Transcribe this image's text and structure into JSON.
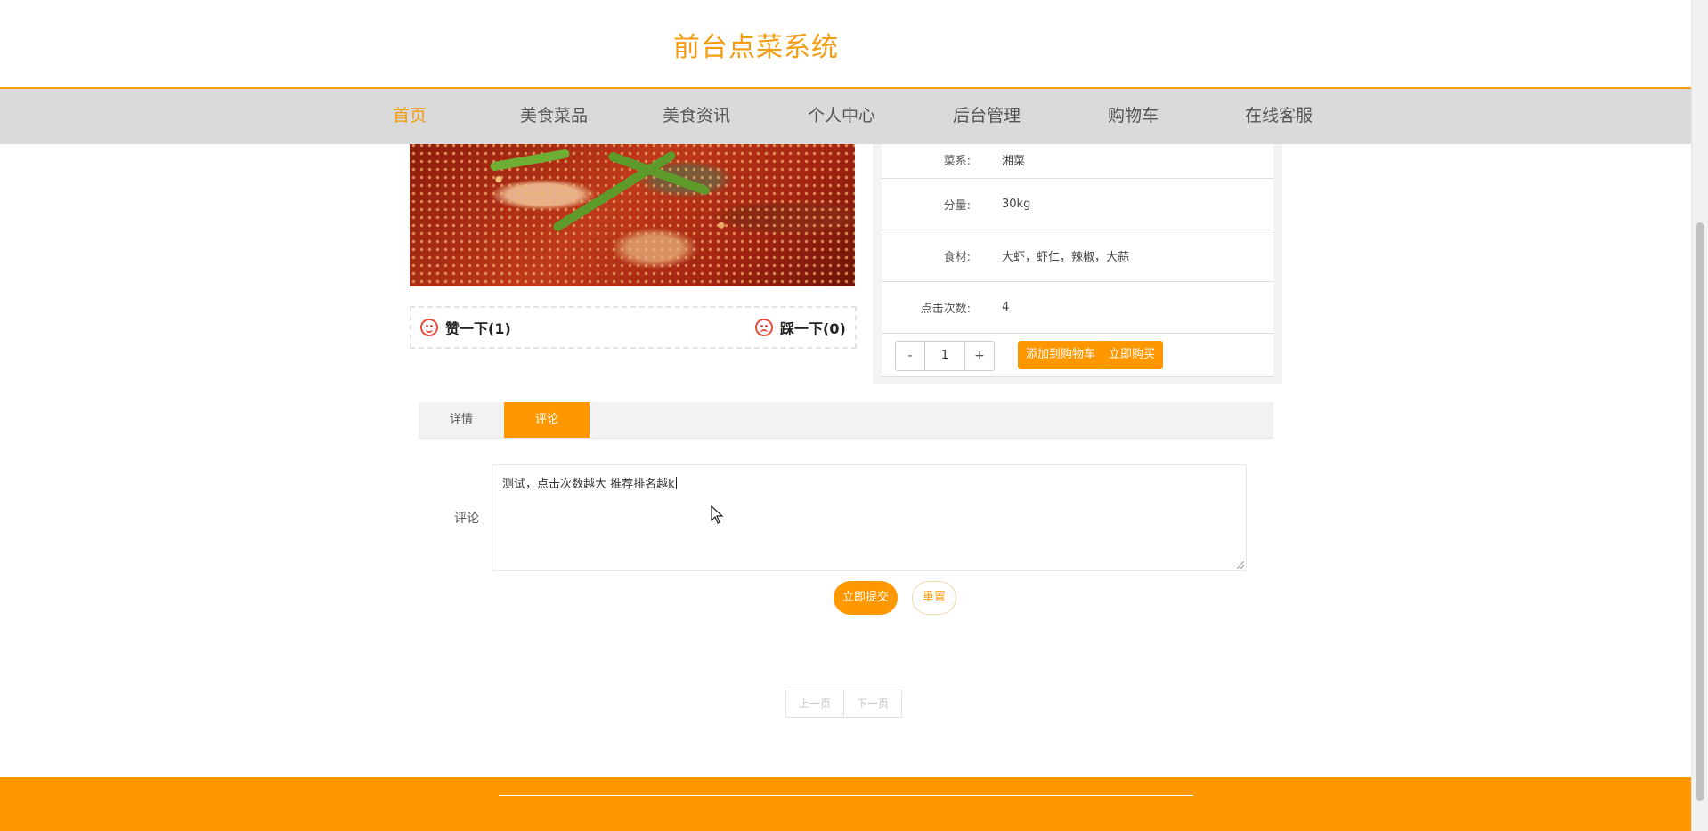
{
  "header": {
    "site_title": "前台点菜系统"
  },
  "nav": {
    "items": [
      {
        "label": "首页",
        "active": true
      },
      {
        "label": "美食菜品",
        "active": false
      },
      {
        "label": "美食资讯",
        "active": false
      },
      {
        "label": "个人中心",
        "active": false
      },
      {
        "label": "后台管理",
        "active": false
      },
      {
        "label": "购物车",
        "active": false
      },
      {
        "label": "在线客服",
        "active": false
      }
    ]
  },
  "votes": {
    "like_label": "赞一下(1)",
    "dislike_label": "踩一下(0)"
  },
  "product_info": {
    "rows": [
      {
        "label": "菜系:",
        "value": "湘菜"
      },
      {
        "label": "分量:",
        "value": "30kg"
      },
      {
        "label": "食材:",
        "value": "大虾，虾仁，辣椒，大蒜"
      },
      {
        "label": "点击次数:",
        "value": "4"
      }
    ],
    "quantity": {
      "minus": "-",
      "value": "1",
      "plus": "+"
    },
    "add_to_cart_label": "添加到购物车",
    "buy_now_label": "立即购买"
  },
  "tabs": [
    {
      "label": "详情",
      "active": false
    },
    {
      "label": "评论",
      "active": true
    }
  ],
  "comment_form": {
    "label": "评论",
    "value": "测试，点击次数越大 推荐排名越k",
    "submit_label": "立即提交",
    "reset_label": "重置"
  },
  "pagination": {
    "prev_label": "上一页",
    "next_label": "下一页"
  },
  "colors": {
    "accent": "#ff9800",
    "nav_background": "#dadada",
    "like_icon": "#e74c3c"
  },
  "icons": {
    "like": "smile-icon",
    "dislike": "frown-icon",
    "pointer": "mouse-pointer-icon"
  }
}
